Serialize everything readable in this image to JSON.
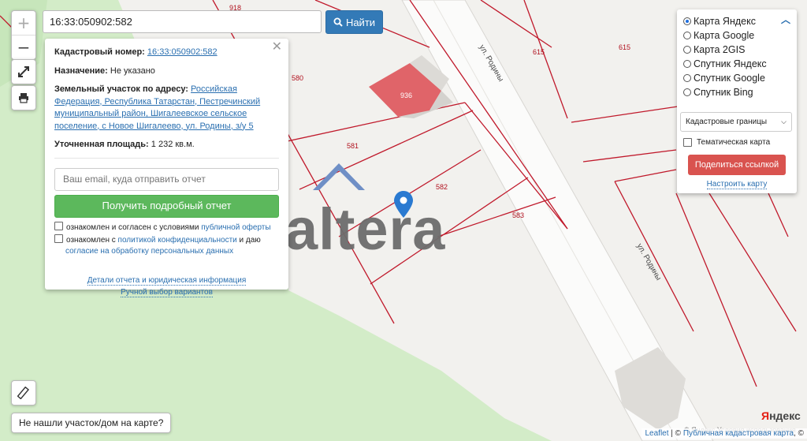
{
  "map": {
    "parcels": {
      "p580": "580",
      "p581": "581",
      "p582": "582",
      "p583": "583",
      "p615a": "615",
      "p615b": "615",
      "p918": "918",
      "p936": "936"
    },
    "streets": {
      "street1": "ул. Родины",
      "street2": "ул. Родины"
    },
    "watermark": "altera",
    "zoom_in_label": "+",
    "zoom_out_label": "−"
  },
  "search": {
    "value": "16:33:050902:582",
    "button_label": "Найти"
  },
  "info": {
    "cad_label": "Кадастровый номер:",
    "cad_value": "16:33:050902:582",
    "purpose_label": "Назначение:",
    "purpose_value": "Не указано",
    "address_label": "Земельный участок по адресу:",
    "address_value": "Российская Федерация, Республика Татарстан, Пестречинский муниципальный район, Шигалеевское сельское поселение, с Новое Шигалеево, ул. Родины, з/у 5",
    "area_label": "Уточненная площадь:",
    "area_value": "1 232 кв.м.",
    "email_placeholder": "Ваш email, куда отправить отчет",
    "report_button": "Получить подробный отчет",
    "consent1_text": "ознакомлен и согласен с условиями",
    "consent1_link": "публичной оферты",
    "consent2_text": "ознакомлен с",
    "consent2_link": "политикой конфиденциальности",
    "consent2_mid": "и даю",
    "consent2_link2": "согласие на обработку персональных данных",
    "details_link": "Детали отчета и юридическая информация",
    "manual_link": "Ручной выбор вариантов"
  },
  "layers": {
    "options": [
      "Карта Яндекс",
      "Карта Google",
      "Карта 2GIS",
      "Спутник Яндекс",
      "Спутник Google",
      "Спутник Bing"
    ],
    "selected": "Карта Яндекс",
    "select_value": "Кадастровые границы",
    "thematic_label": "Тематическая карта",
    "share_button": "Поделиться ссылкой",
    "setup_link": "Настроить карту"
  },
  "not_found_button": "Не нашли участок/дом на карте?",
  "attribution": {
    "leaflet": "Leaflet",
    "sep": " | © ",
    "pkk": "Публичная кадастровая карта",
    "tail": ", ©"
  },
  "yandex": {
    "logo_first": "Я",
    "logo_rest": "ндекс",
    "terms": "© Яндекс  Условия использования"
  },
  "colors": {
    "parcel_line": "#c0192b",
    "building_fill": "#e06469",
    "forest": "#d3ecc8",
    "road": "#ffffff",
    "accent": "#337ab7",
    "green_button": "#5cb85c",
    "red_button": "#d9534f"
  }
}
